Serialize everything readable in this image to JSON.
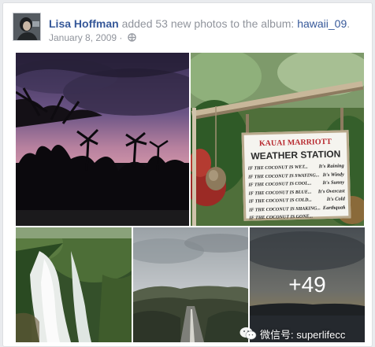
{
  "post": {
    "author": "Lisa Hoffman",
    "action_text": " added 53 new photos to the album: ",
    "album_name": "hawaii_09",
    "album_suffix": ".",
    "date": "January 8, 2009",
    "separator": " · ",
    "privacy_icon": "globe-icon"
  },
  "photos": {
    "more_count_label": "+49",
    "sign": {
      "brand": "KAUAI MARRIOTT",
      "title": "WEATHER STATION",
      "rows": [
        {
          "condition": "IF THE COCONUT IS WET...",
          "result": "It's Raining"
        },
        {
          "condition": "IF THE COCONUT IS SWAYING...",
          "result": "It's Windy"
        },
        {
          "condition": "IF THE COCONUT IS COOL...",
          "result": "It's Sunny"
        },
        {
          "condition": "IF THE COCONUT IS BLUE...",
          "result": "It's Overcast"
        },
        {
          "condition": "IF THE COCONUT IS COLD...",
          "result": "It's Cold"
        },
        {
          "condition": "IF THE COCONUT IS SHAKING...",
          "result": "Earthquake"
        },
        {
          "condition": "IF THE COCONUT IS GONE...",
          "result": ""
        }
      ]
    }
  },
  "watermark": {
    "text": "微信号: superlifecc",
    "icon": "wechat-icon"
  }
}
